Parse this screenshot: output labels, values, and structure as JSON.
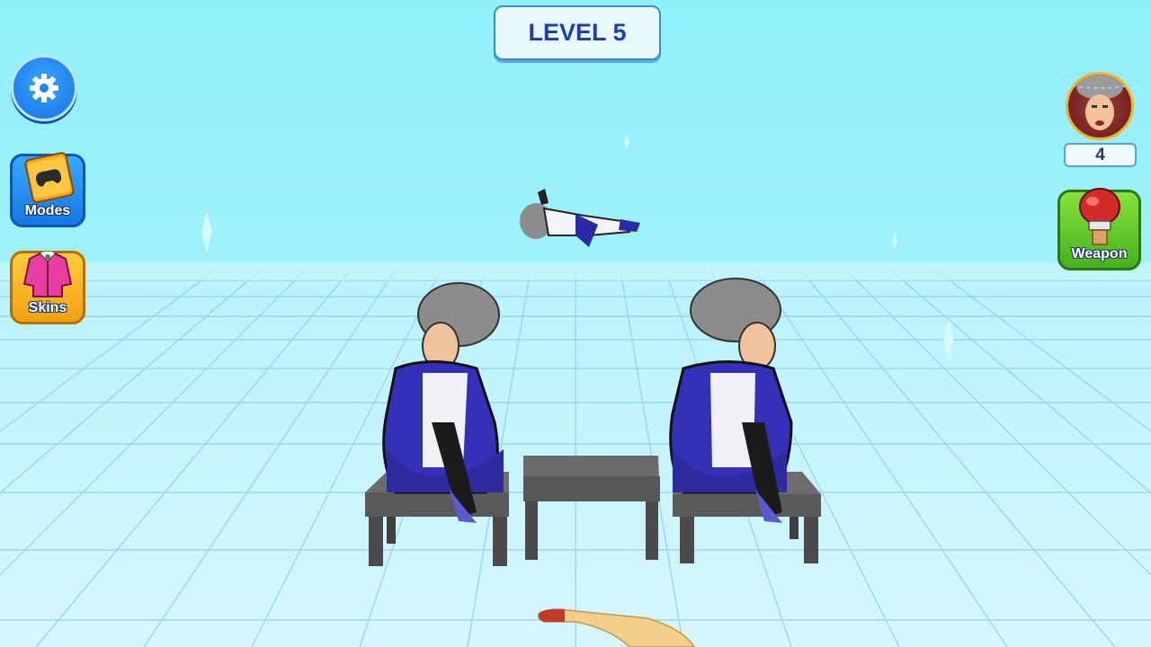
{
  "hud": {
    "level_label": "LEVEL 5",
    "lives_count": "4"
  },
  "buttons": {
    "modes_label": "Modes",
    "skins_label": "Skins",
    "weapon_label": "Weapon"
  },
  "icons": {
    "settings": "gear-icon",
    "modes": "gamepad-book-icon",
    "skins": "jacket-icon",
    "weapon": "boxing-glove-icon"
  },
  "colors": {
    "sky": "#8ff0fb",
    "floor": "#d6f6fc",
    "grid": "#8cc9ee",
    "accent_blue": "#1877e3",
    "modes_blue": "#37a8ff",
    "skins_orange": "#f0a114",
    "weapon_green": "#45b11c",
    "level_text": "#1f3fb0"
  }
}
